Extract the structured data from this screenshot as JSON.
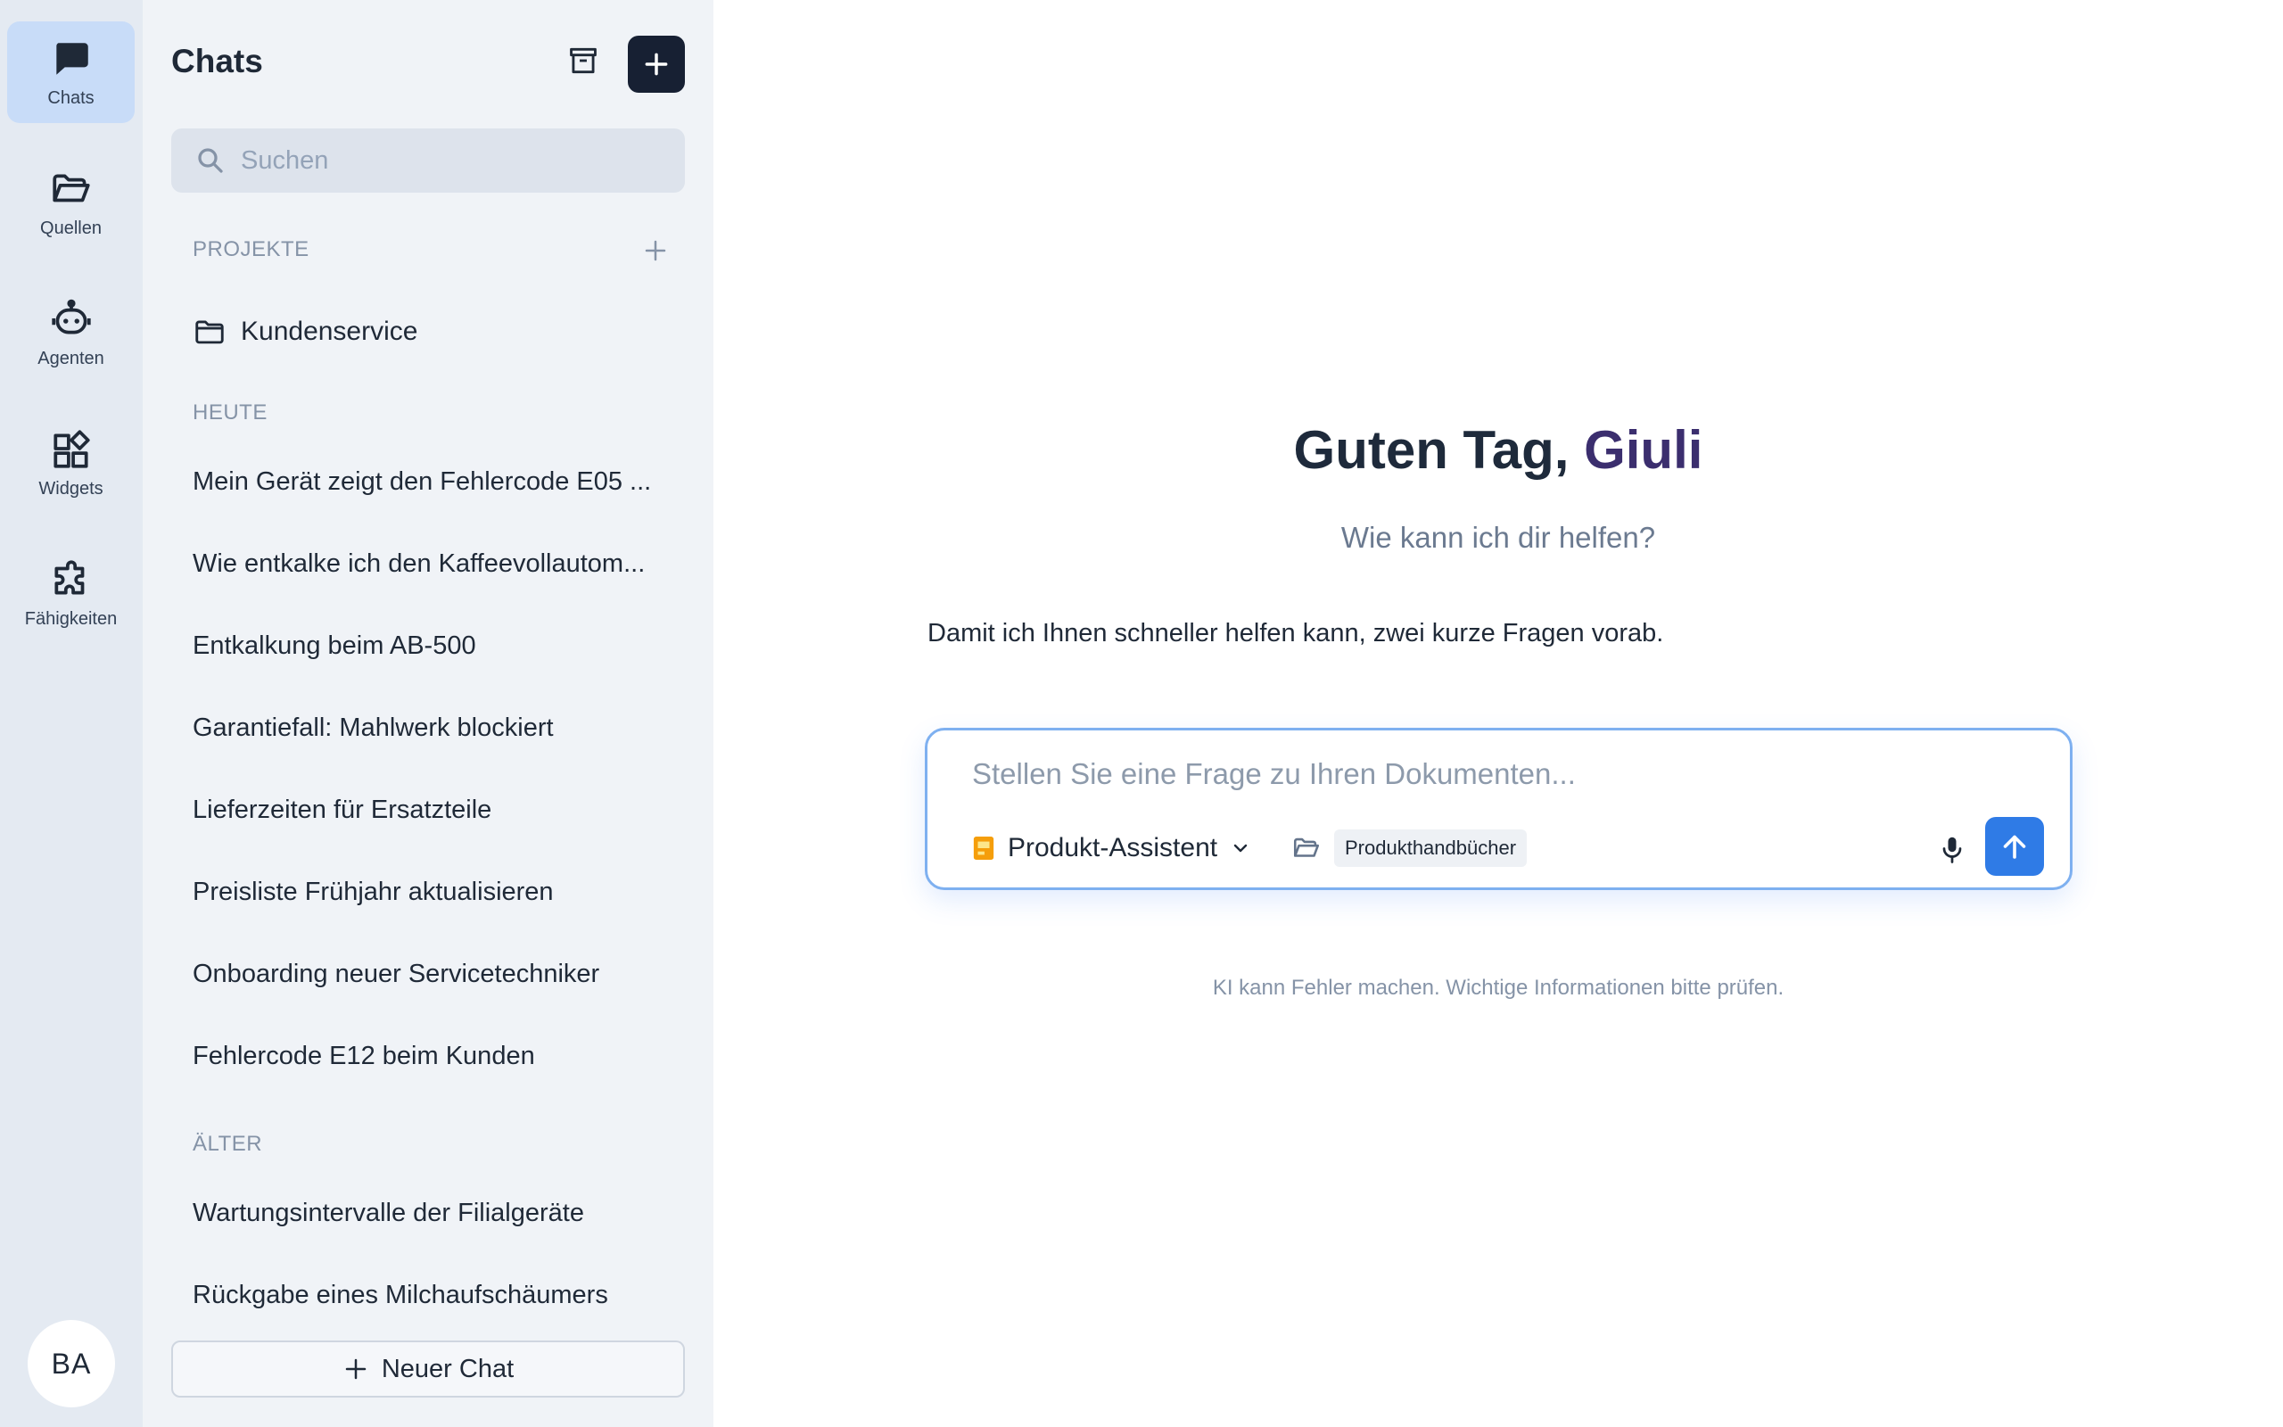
{
  "rail": {
    "items": [
      {
        "label": "Chats",
        "icon": "chat-bubble-icon",
        "active": true
      },
      {
        "label": "Quellen",
        "icon": "folder-open-icon",
        "active": false
      },
      {
        "label": "Agenten",
        "icon": "robot-icon",
        "active": false
      },
      {
        "label": "Widgets",
        "icon": "widgets-icon",
        "active": false
      },
      {
        "label": "Fähigkeiten",
        "icon": "puzzle-icon",
        "active": false
      }
    ],
    "avatar_initials": "BA"
  },
  "sidebar": {
    "title": "Chats",
    "search_placeholder": "Suchen",
    "projects_label": "PROJEKTE",
    "projects": [
      {
        "label": "Kundenservice",
        "icon": "folder-icon"
      }
    ],
    "sections": [
      {
        "label": "HEUTE",
        "items": [
          "Mein Gerät zeigt den Fehlercode E05 ...",
          "Wie entkalke ich den Kaffeevollautom...",
          "Entkalkung beim AB-500",
          "Garantiefall: Mahlwerk blockiert",
          "Lieferzeiten für Ersatzteile",
          "Preisliste Frühjahr aktualisieren",
          "Onboarding neuer Servicetechniker",
          "Fehlercode E12 beim Kunden"
        ]
      },
      {
        "label": "ÄLTER",
        "items": [
          "Wartungsintervalle der Filialgeräte",
          "Rückgabe eines Milchaufschäumers"
        ]
      }
    ],
    "new_chat_label": "Neuer Chat"
  },
  "main": {
    "greeting_prefix": "Guten Tag, ",
    "greeting_name": "Giuli",
    "subtitle": "Wie kann ich dir helfen?",
    "intro": "Damit ich Ihnen schneller helfen kann, zwei kurze Fragen vorab.",
    "composer": {
      "placeholder": "Stellen Sie eine Frage zu Ihren Dokumenten...",
      "agent_label": "Produkt-Assistent",
      "source_label": "Produkthandbücher"
    },
    "disclaimer": "KI kann Fehler machen. Wichtige Informationen bitte prüfen."
  },
  "colors": {
    "accent": "#2f7be6",
    "primary_dark": "#172033",
    "rail_bg": "#e4eaf2",
    "rail_active": "#c8dcf8",
    "sidebar_bg": "#f0f3f7",
    "greeting_name": "#3b2e6e",
    "agent_icon": "#f59e0b"
  }
}
